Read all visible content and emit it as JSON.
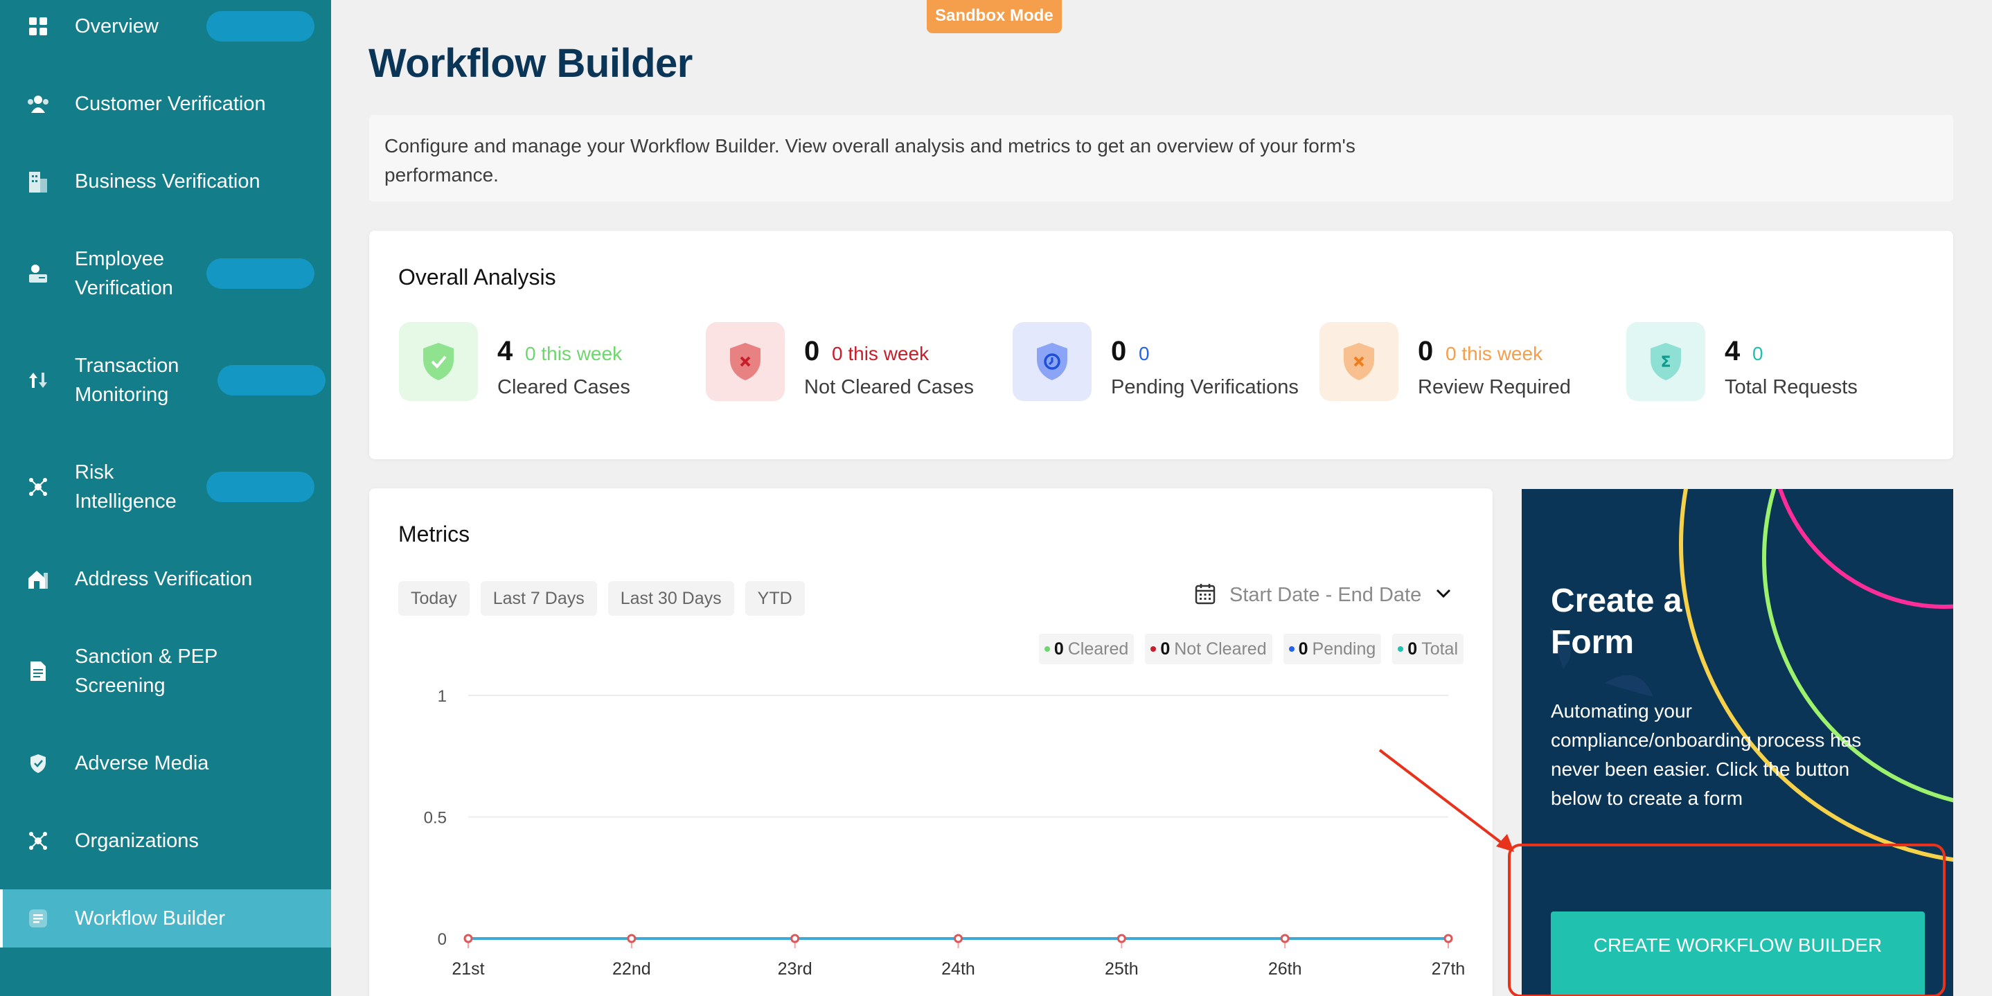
{
  "sidebar": {
    "items": [
      {
        "label": "Overview",
        "icon": "grid-icon"
      },
      {
        "label": "Customer Verification",
        "icon": "users-icon"
      },
      {
        "label": "Business Verification",
        "icon": "building-icon"
      },
      {
        "label": "Employee Verification",
        "icon": "id-card-icon"
      },
      {
        "label": "Transaction Monitoring",
        "icon": "transfer-icon"
      },
      {
        "label": "Risk Intelligence",
        "icon": "network-icon"
      },
      {
        "label": "Address Verification",
        "icon": "house-icon"
      },
      {
        "label": "Sanction & PEP Screening",
        "icon": "document-icon"
      },
      {
        "label": "Adverse Media",
        "icon": "shield-check-icon"
      },
      {
        "label": "Organizations",
        "icon": "network-icon"
      },
      {
        "label": "Workflow Builder",
        "icon": "form-icon",
        "active": true
      }
    ]
  },
  "badge": {
    "sandbox": "Sandbox Mode"
  },
  "header": {
    "title": "Workflow Builder",
    "description": "Configure and manage your Workflow Builder. View overall analysis and metrics to get an overview of your form's performance."
  },
  "analysis": {
    "title": "Overall Analysis",
    "stats": [
      {
        "value": "4",
        "week": "0 this week",
        "label": "Cleared Cases",
        "color": "#6fd66f",
        "icon": "shield-check-icon"
      },
      {
        "value": "0",
        "week": "0 this week",
        "label": "Not Cleared Cases",
        "color": "#c81e2b",
        "icon": "shield-x-icon"
      },
      {
        "value": "0",
        "week": "0",
        "label": "Pending Verifications",
        "color": "#2563eb",
        "icon": "shield-clock-icon"
      },
      {
        "value": "0",
        "week": "0 this week",
        "label": "Review Required",
        "color": "#f59e4b",
        "icon": "shield-x-icon"
      },
      {
        "value": "4",
        "week": "0",
        "label": "Total Requests",
        "color": "#20c1ae",
        "icon": "shield-sigma-icon"
      }
    ]
  },
  "metrics": {
    "title": "Metrics",
    "filters": [
      "Today",
      "Last 7 Days",
      "Last 30 Days",
      "YTD"
    ],
    "date_range": "Start Date - End Date",
    "legend": [
      {
        "count": "0",
        "label": "Cleared",
        "color": "#6fd66f"
      },
      {
        "count": "0",
        "label": "Not Cleared",
        "color": "#c81e2b"
      },
      {
        "count": "0",
        "label": "Pending",
        "color": "#2563eb"
      },
      {
        "count": "0",
        "label": "Total",
        "color": "#20c1ae"
      }
    ]
  },
  "chart_data": {
    "type": "line",
    "x": [
      "21st",
      "22nd",
      "23rd",
      "24th",
      "25th",
      "26th",
      "27th"
    ],
    "series": [
      {
        "name": "Cleared",
        "values": [
          0,
          0,
          0,
          0,
          0,
          0,
          0
        ]
      },
      {
        "name": "Not Cleared",
        "values": [
          0,
          0,
          0,
          0,
          0,
          0,
          0
        ]
      },
      {
        "name": "Pending",
        "values": [
          0,
          0,
          0,
          0,
          0,
          0,
          0
        ]
      },
      {
        "name": "Total",
        "values": [
          0,
          0,
          0,
          0,
          0,
          0,
          0
        ]
      }
    ],
    "yticks": [
      "0",
      "0.5",
      "1"
    ],
    "ylim": [
      0,
      1
    ],
    "grid": true
  },
  "create_form": {
    "title": "Create a Form",
    "text": "Automating your compliance/onboarding process has never been easier. Click the button below to create a form",
    "button": "CREATE WORKFLOW BUILDER"
  }
}
